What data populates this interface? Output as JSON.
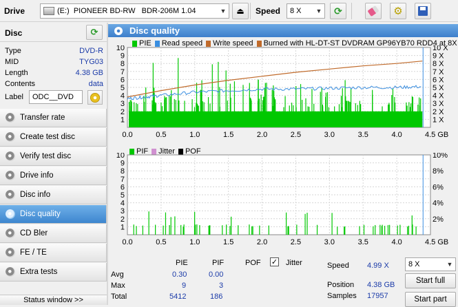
{
  "toolbar": {
    "drive_label": "Drive",
    "drive_value": "(E:)  PIONEER BD-RW   BDR-206M 1.04",
    "speed_label": "Speed",
    "speed_value": "8 X"
  },
  "disc": {
    "title": "Disc",
    "rows": [
      {
        "key": "Type",
        "value": "DVD-R"
      },
      {
        "key": "MID",
        "value": "TYG03"
      },
      {
        "key": "Length",
        "value": "4.38 GB"
      },
      {
        "key": "Contents",
        "value": "data"
      }
    ],
    "label_key": "Label",
    "label_value": "ODC__DVD"
  },
  "nav": [
    {
      "label": "Transfer rate",
      "active": false
    },
    {
      "label": "Create test disc",
      "active": false
    },
    {
      "label": "Verify test disc",
      "active": false
    },
    {
      "label": "Drive info",
      "active": false
    },
    {
      "label": "Disc info",
      "active": false
    },
    {
      "label": "Disc quality",
      "active": true
    },
    {
      "label": "CD Bler",
      "active": false
    },
    {
      "label": "FE / TE",
      "active": false
    },
    {
      "label": "Extra tests",
      "active": false
    }
  ],
  "status_window": "Status window >>",
  "main_title": "Disc quality",
  "colors": {
    "pie": "#00c800",
    "read": "#3a8ee0",
    "write": "#c06a2a",
    "burned": "#c06a2a",
    "pif": "#00c800",
    "jitter": "#d090d0",
    "pof": "#000000",
    "accent": "#3d7fcb",
    "value_text": "#1a3aa8"
  },
  "chart_data": [
    {
      "type": "bar",
      "legend": [
        {
          "name": "PIE",
          "color": "#00c800"
        },
        {
          "name": "Read speed",
          "color": "#3a8ee0"
        },
        {
          "name": "Write speed",
          "color": "#c06a2a"
        },
        {
          "name": "Burned with HL-DT-ST DVDRAM GP96YB70 RDD4 at 8X",
          "color": "#c06a2a"
        }
      ],
      "xlim": [
        0,
        4.5
      ],
      "ylim": [
        0,
        10
      ],
      "x_ticks": [
        "0.0",
        "0.5",
        "1.0",
        "1.5",
        "2.0",
        "2.5",
        "3.0",
        "3.5",
        "4.0",
        "4.5 GB"
      ],
      "y_ticks_left": [
        "1",
        "2",
        "3",
        "4",
        "5",
        "6",
        "7",
        "8",
        "9",
        "10"
      ],
      "y_ticks_right": [
        "1 X",
        "2 X",
        "3 X",
        "4 X",
        "5 X",
        "6 X",
        "7 X",
        "8 X",
        "9 X",
        "10 X"
      ],
      "pie_baseline": 2,
      "pie_max": 9,
      "read_speed": {
        "x": [
          0,
          0.25,
          0.5,
          1.0,
          1.5,
          2.0,
          2.5,
          3.0,
          3.5,
          4.0,
          4.38
        ],
        "y": [
          3.6,
          3.8,
          4.0,
          4.4,
          4.6,
          4.8,
          4.8,
          4.9,
          5.0,
          5.0,
          5.1
        ]
      },
      "write_speed": {
        "x": [
          0,
          0.5,
          1.0,
          1.5,
          2.0,
          2.5,
          3.0,
          3.5,
          4.0,
          4.38
        ],
        "y": [
          3.8,
          4.6,
          5.3,
          5.9,
          6.4,
          6.9,
          7.3,
          7.7,
          8.0,
          8.3
        ]
      }
    },
    {
      "type": "bar",
      "legend": [
        {
          "name": "PIF",
          "color": "#00c800"
        },
        {
          "name": "Jitter",
          "color": "#d090d0"
        },
        {
          "name": "POF",
          "color": "#000000"
        }
      ],
      "xlim": [
        0,
        4.5
      ],
      "ylim": [
        0,
        10
      ],
      "x_ticks": [
        "0.0",
        "0.5",
        "1.0",
        "1.5",
        "2.0",
        "2.5",
        "3.0",
        "3.5",
        "4.0",
        "4.5 GB"
      ],
      "y_ticks_left": [
        "1",
        "2",
        "3",
        "4",
        "5",
        "6",
        "7",
        "8",
        "9",
        "10"
      ],
      "y_ticks_right": [
        "2%",
        "4%",
        "6%",
        "8%",
        "10%"
      ],
      "pif_max": 3
    }
  ],
  "stats": {
    "col_pie": "PIE",
    "col_pif": "PIF",
    "col_pof": "POF",
    "jitter_label": "Jitter",
    "jitter_checked": "✓",
    "rows": [
      {
        "label": "Avg",
        "pie": "0.30",
        "pif": "0.00"
      },
      {
        "label": "Max",
        "pie": "9",
        "pif": "3"
      },
      {
        "label": "Total",
        "pie": "5412",
        "pif": "186"
      }
    ],
    "speed_label": "Speed",
    "speed_value": "4.99 X",
    "position_label": "Position",
    "position_value": "4.38 GB",
    "samples_label": "Samples",
    "samples_value": "17957",
    "speed_select": "8 X",
    "start_full": "Start full",
    "start_part": "Start part"
  }
}
